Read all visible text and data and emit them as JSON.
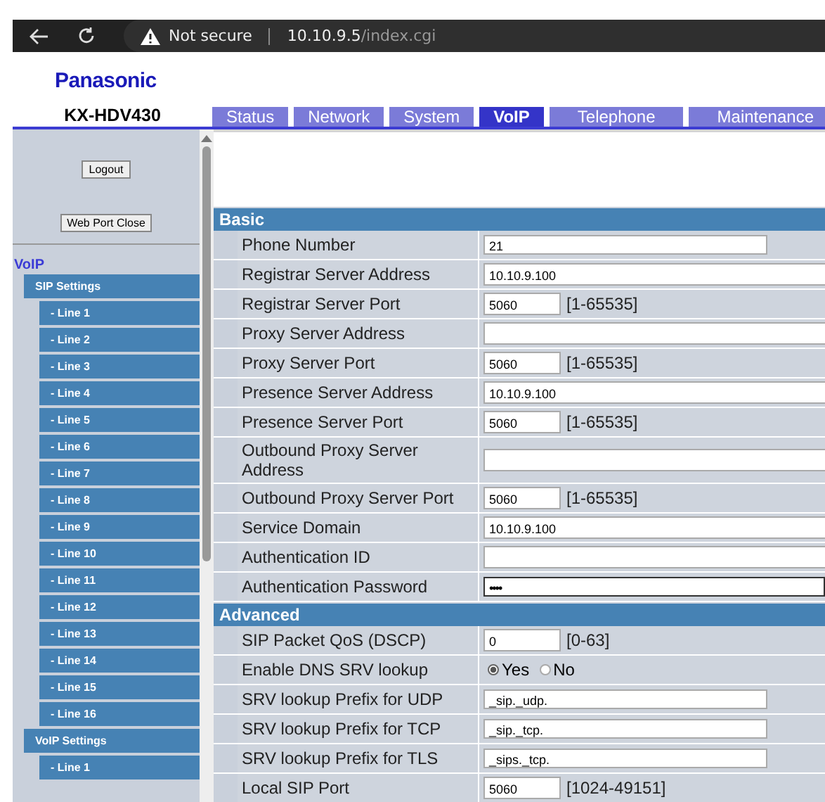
{
  "browser": {
    "security": "Not secure",
    "url_host": "10.10.9.5",
    "url_path": "/index.cgi"
  },
  "header": {
    "brand": "Panasonic",
    "model": "KX-HDV430"
  },
  "tabs": [
    {
      "label": "Status",
      "selected": false
    },
    {
      "label": "Network",
      "selected": false
    },
    {
      "label": "System",
      "selected": false
    },
    {
      "label": "VoIP",
      "selected": true
    },
    {
      "label": "Telephone",
      "selected": false
    },
    {
      "label": "Maintenance",
      "selected": false
    }
  ],
  "sidebar": {
    "buttons": [
      "Logout",
      "Web Port Close"
    ],
    "heading": "VoIP",
    "groups": [
      {
        "label": "SIP Settings",
        "children": [
          "- Line 1",
          "- Line 2",
          "- Line 3",
          "- Line 4",
          "- Line 5",
          "- Line 6",
          "- Line 7",
          "- Line 8",
          "- Line 9",
          "- Line 10",
          "- Line 11",
          "- Line 12",
          "- Line 13",
          "- Line 14",
          "- Line 15",
          "- Line 16"
        ]
      },
      {
        "label": "VoIP Settings",
        "children": [
          "- Line 1"
        ]
      }
    ]
  },
  "sections": [
    {
      "title": "Basic",
      "rows": [
        {
          "label": "Phone Number",
          "kind": "medium",
          "value": "21"
        },
        {
          "label": "Registrar Server Address",
          "kind": "wide",
          "value": "10.10.9.100"
        },
        {
          "label": "Registrar Server Port",
          "kind": "short",
          "value": "5060",
          "range": "[1-65535]"
        },
        {
          "label": "Proxy Server Address",
          "kind": "wide"
        },
        {
          "label": "Proxy Server Port",
          "kind": "short",
          "value": "5060",
          "range": "[1-65535]"
        },
        {
          "label": "Presence Server Address",
          "kind": "wide",
          "value": "10.10.9.100"
        },
        {
          "label": "Presence Server Port",
          "kind": "short",
          "value": "5060",
          "range": "[1-65535]"
        },
        {
          "label": "Outbound Proxy Server Address",
          "kind": "wide"
        },
        {
          "label": "Outbound Proxy Server Port",
          "kind": "short",
          "value": "5060",
          "range": "[1-65535]"
        },
        {
          "label": "Service Domain",
          "kind": "wide",
          "value": "10.10.9.100"
        },
        {
          "label": "Authentication ID",
          "kind": "wide"
        },
        {
          "label": "Authentication Password",
          "kind": "password",
          "value": "••••"
        }
      ]
    },
    {
      "title": "Advanced",
      "rows": [
        {
          "label": "SIP Packet QoS (DSCP)",
          "kind": "short",
          "value": "0",
          "range": "[0-63]"
        },
        {
          "label": "Enable DNS SRV lookup",
          "kind": "radio",
          "options": [
            {
              "label": "Yes",
              "selected": true
            },
            {
              "label": "No",
              "selected": false
            }
          ]
        },
        {
          "label": "SRV lookup Prefix for UDP",
          "kind": "medium",
          "value": "_sip._udp."
        },
        {
          "label": "SRV lookup Prefix for TCP",
          "kind": "medium",
          "value": "_sip._tcp."
        },
        {
          "label": "SRV lookup Prefix for TLS",
          "kind": "medium",
          "value": "_sips._tcp."
        },
        {
          "label": "Local SIP Port",
          "kind": "short",
          "value": "5060",
          "range": "[1024-49151]"
        }
      ]
    }
  ]
}
